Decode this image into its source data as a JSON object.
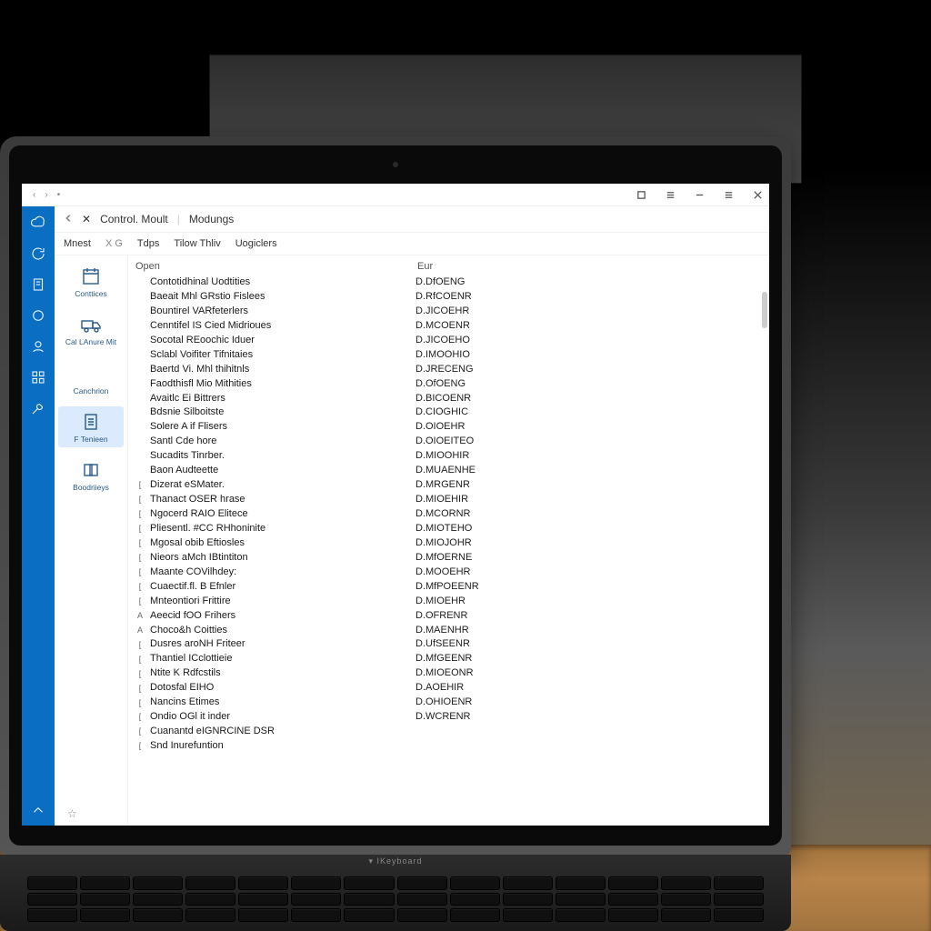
{
  "hinge_label": "▾ IKeyboard",
  "titlebar": {
    "left_glyphs": [
      "‹",
      "›",
      "•",
      "·",
      "·"
    ],
    "buttons": {
      "restore": "❐",
      "menu1": "≡",
      "min": "—",
      "menu2": "≡",
      "close": "✕"
    }
  },
  "rail": [
    {
      "name": "cloud-icon"
    },
    {
      "name": "refresh-icon"
    },
    {
      "name": "page-icon"
    },
    {
      "name": "circle-icon"
    },
    {
      "name": "user-icon"
    },
    {
      "name": "grid-icon"
    },
    {
      "name": "tool-icon"
    }
  ],
  "rail_bottom": {
    "name": "caret-up-icon"
  },
  "crumbs": {
    "back": "‹",
    "close": "✕",
    "a": "Control. Moult",
    "b": "Modungs"
  },
  "menus": [
    "Mnest",
    "X  G",
    "Tdps",
    "Tilow  Thliv",
    "Uogiclers"
  ],
  "columns": {
    "open": "Open",
    "eur": "Eur"
  },
  "sidebar": [
    {
      "name": "contices",
      "label": "Conttices",
      "icon": "calendar"
    },
    {
      "name": "cal-lanure",
      "label": "Cal LAnure Mit",
      "icon": "truck"
    },
    {
      "name": "canchrion",
      "label": "Canchrion",
      "icon": ""
    },
    {
      "name": "ftenieen",
      "label": "F Tenieen",
      "icon": "doc",
      "selected": true
    },
    {
      "name": "boodrieys",
      "label": "Boodriieys",
      "icon": "stack"
    }
  ],
  "rows": [
    {
      "i": "",
      "n": "Contotidhinal Uodtities",
      "v": "D.DfOENG"
    },
    {
      "i": "",
      "n": "Baeait Mhl GRstio Fislees",
      "v": "D.RfCOENR"
    },
    {
      "i": "",
      "n": "Bountirel VARfeterlers",
      "v": "D.JICOEHR"
    },
    {
      "i": "",
      "n": "Cenntifel IS Cied Midrioues",
      "v": "D.MCOENR"
    },
    {
      "i": "",
      "n": "Socotal REoochic Iduer",
      "v": "D.JICOEHO"
    },
    {
      "i": "",
      "n": "Sclabl Voifiter Tifnitaies",
      "v": "D.IMOOHIO"
    },
    {
      "i": "",
      "n": "Baertd Vi. Mhl thihitnls",
      "v": "D.JRECENG"
    },
    {
      "i": "",
      "n": "Faodthisfl Mio Mithities",
      "v": "D.OfOENG"
    },
    {
      "i": "",
      "n": "Avaitlc Ei Bittrers",
      "v": "D.BICOENR"
    },
    {
      "i": "",
      "n": "Bdsnie Silboitste",
      "v": "D.CIOGHIC"
    },
    {
      "i": "",
      "n": "Solere A if Flisers",
      "v": "D.OIOEHR"
    },
    {
      "i": "",
      "n": "Santl Cde hore",
      "v": "D.OIOEITEO"
    },
    {
      "i": "",
      "n": "Sucadits Tinrber.",
      "v": "D.MIOOHIR"
    },
    {
      "i": "",
      "n": "Baon Audteette",
      "v": "D.MUAENHE"
    },
    {
      "i": "[",
      "n": "Dizerat eSMater.",
      "v": "D.MRGENR"
    },
    {
      "i": "[",
      "n": "Thanact OSER hrase",
      "v": "D.MIOEHIR"
    },
    {
      "i": "[",
      "n": "Ngocerd RAIO Elitece",
      "v": "D.MCORNR"
    },
    {
      "i": "[",
      "n": "Pliesentl. #CC RHhoninite",
      "v": "D.MIOTEHO"
    },
    {
      "i": "[",
      "n": "Mgosal obib Eftiosles",
      "v": "D.MIOJOHR"
    },
    {
      "i": "[",
      "n": "Nieors aMch IBtintiton",
      "v": "D.MfOERNE"
    },
    {
      "i": "[",
      "n": "Maante COVilhdey:",
      "v": "D.MOOEHR"
    },
    {
      "i": "[",
      "n": "Cuaectif.fl. B Efnler",
      "v": "D.MfPOEENR"
    },
    {
      "i": "[",
      "n": "Mnteontiori Frittire",
      "v": "D.MIOEHR"
    },
    {
      "i": "A",
      "n": "Aeecid fOO Frihers",
      "v": "D.OFRENR"
    },
    {
      "i": "A",
      "n": "Choco&h Coitties",
      "v": "D.MAENHR"
    },
    {
      "i": "[",
      "n": "Dusres aroNH Friteer",
      "v": "D.UfSEENR"
    },
    {
      "i": "[",
      "n": "Thantiel ICclottieie",
      "v": "D.MfGEENR"
    },
    {
      "i": "[",
      "n": "Ntite K Rdfcstils",
      "v": "D.MIOEONR"
    },
    {
      "i": "[",
      "n": "Dotosfal EIHO",
      "v": "D.AOEHIR"
    },
    {
      "i": "[",
      "n": "Nancins Etimes",
      "v": "D.OHIOENR"
    },
    {
      "i": "[",
      "n": "Ondio OGl it inder",
      "v": "D.WCRENR"
    },
    {
      "i": "[",
      "n": "Cuanantd eIGNRCINE DSR",
      "v": ""
    },
    {
      "i": "[",
      "n": "Snd Inurefuntion",
      "v": ""
    }
  ],
  "footer_glyph": "☆"
}
